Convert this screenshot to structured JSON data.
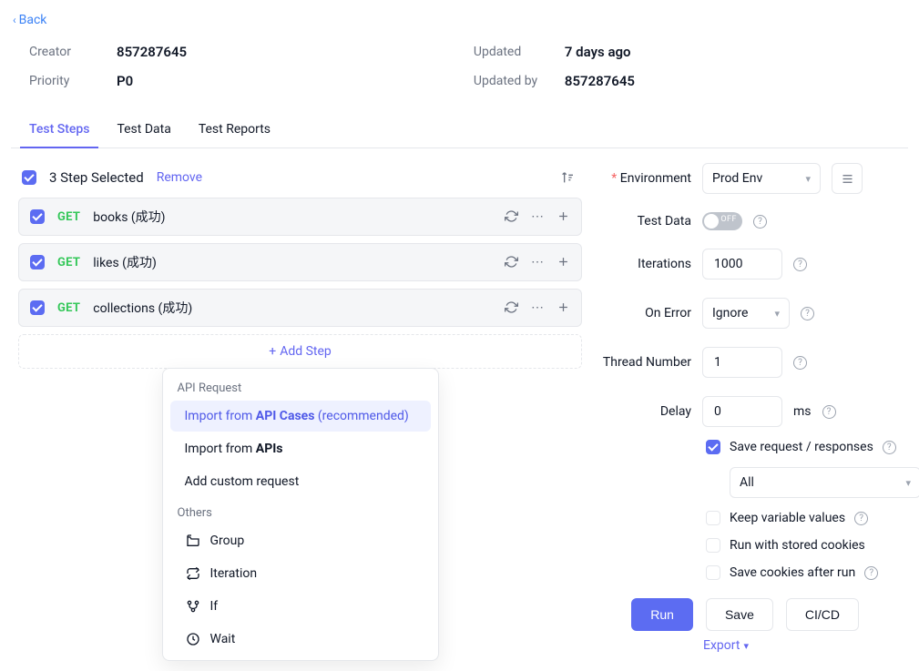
{
  "nav": {
    "back": "Back"
  },
  "meta": {
    "creator_label": "Creator",
    "creator": "857287645",
    "priority_label": "Priority",
    "priority": "P0",
    "updated_label": "Updated",
    "updated": "7 days ago",
    "updated_by_label": "Updated by",
    "updated_by": "857287645"
  },
  "tabs": {
    "steps": "Test Steps",
    "data": "Test Data",
    "reports": "Test Reports"
  },
  "selection": {
    "text": "3 Step Selected",
    "remove": "Remove"
  },
  "steps": [
    {
      "method": "GET",
      "name": "books (成功)"
    },
    {
      "method": "GET",
      "name": "likes (成功)"
    },
    {
      "method": "GET",
      "name": "collections (成功)"
    }
  ],
  "add_step": {
    "label": "Add Step"
  },
  "dropdown": {
    "section_api": "API Request",
    "import_cases_pre": "Import from ",
    "import_cases_bold": "API Cases",
    "import_cases_post": " (recommended)",
    "import_apis_pre": "Import from ",
    "import_apis_bold": "APIs",
    "add_custom": "Add custom request",
    "section_others": "Others",
    "group": "Group",
    "iteration": "Iteration",
    "if": "If",
    "wait": "Wait"
  },
  "config": {
    "environment_label": "Environment",
    "environment_value": "Prod Env",
    "test_data_label": "Test Data",
    "test_data_toggle": "OFF",
    "iterations_label": "Iterations",
    "iterations_value": "1000",
    "on_error_label": "On Error",
    "on_error_value": "Ignore",
    "threads_label": "Thread Number",
    "threads_value": "1",
    "delay_label": "Delay",
    "delay_value": "0",
    "delay_unit": "ms",
    "save_req_label": "Save request / responses",
    "save_req_select": "All",
    "keep_vars_label": "Keep variable values",
    "stored_cookies_label": "Run with stored cookies",
    "save_cookies_label": "Save cookies after run"
  },
  "actions": {
    "run": "Run",
    "save": "Save",
    "cicd": "CI/CD",
    "export": "Export"
  }
}
